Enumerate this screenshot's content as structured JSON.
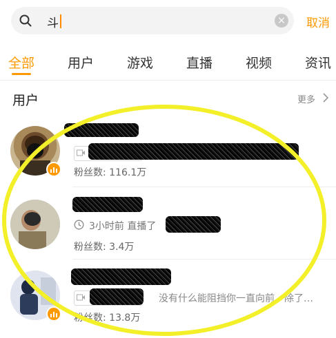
{
  "search": {
    "query": "斗",
    "clear_symbol": "×",
    "cancel_label": "取消"
  },
  "tabs": [
    {
      "label": "全部",
      "active": true
    },
    {
      "label": "用户",
      "active": false
    },
    {
      "label": "游戏",
      "active": false
    },
    {
      "label": "直播",
      "active": false
    },
    {
      "label": "视频",
      "active": false
    },
    {
      "label": "资讯",
      "active": false
    }
  ],
  "section": {
    "title": "用户",
    "more_label": "更多"
  },
  "users": [
    {
      "fans": "粉丝数: 116.1万"
    },
    {
      "recent": "3小时前 直播了",
      "fans": "粉丝数: 3.4万"
    },
    {
      "description": "没有什么能阻挡你一直向前，除了…",
      "fans": "粉丝数: 13.8万"
    }
  ],
  "colors": {
    "accent": "#ff9900",
    "highlight_ellipse": "#f3f02a"
  }
}
